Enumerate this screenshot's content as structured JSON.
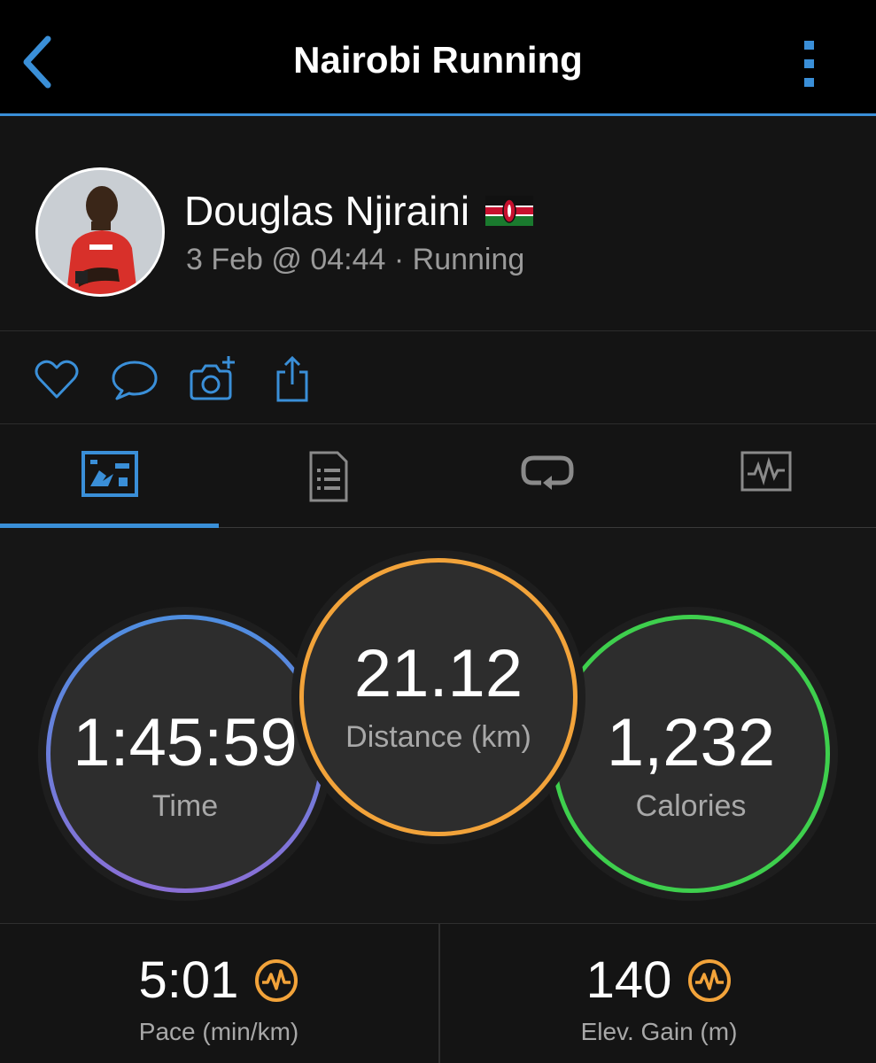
{
  "header": {
    "title": "Nairobi Running"
  },
  "profile": {
    "name": "Douglas Njiraini",
    "meta": "3 Feb @ 04:44 · Running"
  },
  "stats": {
    "time": {
      "value": "1:45:59",
      "label": "Time"
    },
    "distance": {
      "value": "21.12",
      "label": "Distance (km)"
    },
    "calories": {
      "value": "1,232",
      "label": "Calories"
    }
  },
  "details": {
    "pace": {
      "value": "5:01",
      "label": "Pace (min/km)"
    },
    "elevation": {
      "value": "140",
      "label": "Elev. Gain (m)"
    }
  },
  "colors": {
    "accent": "#3a8fd8",
    "time_ring": "#4e8ee0",
    "distance_ring": "#f2a33a",
    "calories_ring": "#3ecf4d",
    "background": "#121212"
  }
}
